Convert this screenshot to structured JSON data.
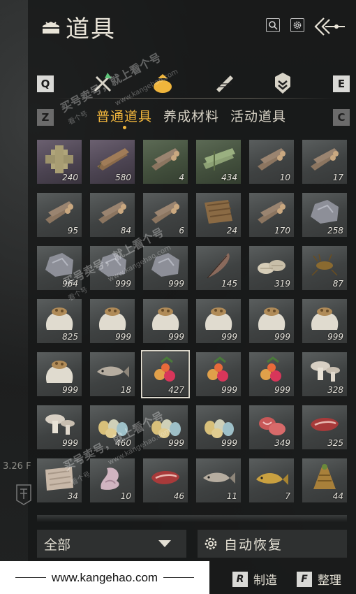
{
  "window": {
    "title": "道具"
  },
  "header": {
    "search_icon": "search-icon",
    "settings_icon": "gear-icon",
    "back_icon": "back-arrow-icon"
  },
  "category_bar": {
    "prev_key": "Q",
    "next_key": "E",
    "icons": [
      "combat-icon",
      "money-bag-icon",
      "scroll-icon",
      "badge-icon"
    ],
    "active_index": 1
  },
  "subtab_bar": {
    "prev_key": "Z",
    "next_key": "C",
    "tabs": [
      "普通道具",
      "养成材料",
      "活动道具"
    ],
    "active_index": 0
  },
  "items": [
    {
      "icon": "wood-block-icon",
      "qty": "240",
      "tint": "purple"
    },
    {
      "icon": "wood-plank-icon",
      "qty": "580",
      "tint": "purple"
    },
    {
      "icon": "log-bundle-icon",
      "qty": "4",
      "tint": "green"
    },
    {
      "icon": "bamboo-bundle-icon",
      "qty": "434",
      "tint": "green"
    },
    {
      "icon": "log-bundle-icon",
      "qty": "10",
      "tint": "gray"
    },
    {
      "icon": "log-bundle-icon",
      "qty": "17",
      "tint": "gray"
    },
    {
      "icon": "log-bundle-icon",
      "qty": "95",
      "tint": "gray"
    },
    {
      "icon": "log-bundle-icon",
      "qty": "84",
      "tint": "gray"
    },
    {
      "icon": "log-bundle-icon",
      "qty": "6",
      "tint": "gray"
    },
    {
      "icon": "bark-icon",
      "qty": "24",
      "tint": "gray"
    },
    {
      "icon": "log-bundle-icon",
      "qty": "170",
      "tint": "gray"
    },
    {
      "icon": "ore-stone-icon",
      "qty": "258",
      "tint": "gray"
    },
    {
      "icon": "ore-stone-icon",
      "qty": "964",
      "tint": "gray"
    },
    {
      "icon": "ore-stone-icon",
      "qty": "999",
      "tint": "gray"
    },
    {
      "icon": "ore-stone-icon",
      "qty": "999",
      "tint": "gray"
    },
    {
      "icon": "feather-icon",
      "qty": "145",
      "tint": "gray"
    },
    {
      "icon": "shell-icon",
      "qty": "319",
      "tint": "gray"
    },
    {
      "icon": "insect-icon",
      "qty": "87",
      "tint": "gray"
    },
    {
      "icon": "grain-sack-icon",
      "qty": "825",
      "tint": "gray"
    },
    {
      "icon": "grain-sack-icon",
      "qty": "999",
      "tint": "gray"
    },
    {
      "icon": "grain-sack-icon",
      "qty": "999",
      "tint": "gray"
    },
    {
      "icon": "grain-sack-icon",
      "qty": "999",
      "tint": "gray"
    },
    {
      "icon": "grain-sack-icon",
      "qty": "999",
      "tint": "gray"
    },
    {
      "icon": "grain-sack-icon",
      "qty": "999",
      "tint": "gray"
    },
    {
      "icon": "grain-sack-icon",
      "qty": "999",
      "tint": "gray"
    },
    {
      "icon": "fish-icon",
      "qty": "18",
      "tint": "gray"
    },
    {
      "icon": "fruit-icon",
      "qty": "427",
      "tint": "gray",
      "selected": true
    },
    {
      "icon": "fruit-icon",
      "qty": "999",
      "tint": "gray"
    },
    {
      "icon": "fruit-icon",
      "qty": "999",
      "tint": "gray"
    },
    {
      "icon": "mushroom-icon",
      "qty": "328",
      "tint": "gray"
    },
    {
      "icon": "mushroom-icon",
      "qty": "999",
      "tint": "gray"
    },
    {
      "icon": "eggs-icon",
      "qty": "460",
      "tint": "gray"
    },
    {
      "icon": "eggs-icon",
      "qty": "999",
      "tint": "gray"
    },
    {
      "icon": "eggs-icon",
      "qty": "999",
      "tint": "gray"
    },
    {
      "icon": "raw-meat-icon",
      "qty": "349",
      "tint": "gray"
    },
    {
      "icon": "steak-icon",
      "qty": "325",
      "tint": "gray"
    },
    {
      "icon": "hide-icon",
      "qty": "34",
      "tint": "gray"
    },
    {
      "icon": "tripe-icon",
      "qty": "10",
      "tint": "gray"
    },
    {
      "icon": "steak-icon",
      "qty": "46",
      "tint": "gray"
    },
    {
      "icon": "fish-icon",
      "qty": "11",
      "tint": "gray"
    },
    {
      "icon": "carp-icon",
      "qty": "7",
      "tint": "gray"
    },
    {
      "icon": "herb-root-icon",
      "qty": "44",
      "tint": "gray"
    }
  ],
  "filter": {
    "label": "全部"
  },
  "auto_restore": {
    "label": "自动恢复"
  },
  "actions": [
    {
      "key": "R",
      "label": "制造"
    },
    {
      "key": "F",
      "label": "整理"
    }
  ],
  "watermark": {
    "url": "www.kangehao.com",
    "stamp": "买号卖号，就上看个号",
    "site": "www.kangehao.com",
    "sub": "看个号"
  },
  "side": {
    "text": "3.26 F"
  },
  "colors": {
    "accent": "#f0b53c",
    "text": "#e4e0d4",
    "cell": "#4a4d4d"
  }
}
